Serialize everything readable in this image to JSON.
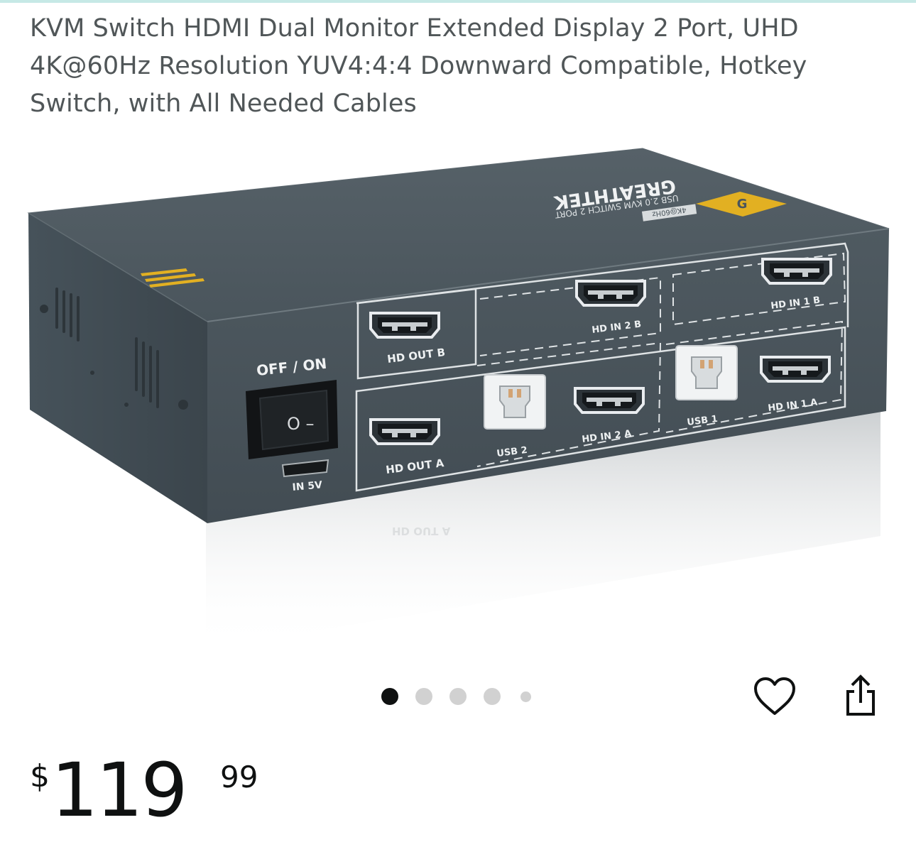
{
  "product": {
    "title": "KVM Switch HDMI Dual Monitor Extended Display 2 Port, UHD 4K@60Hz Resolution YUV4:4:4 Downward Compatible, Hotkey Switch, with All Needed Cables"
  },
  "device_labels": {
    "brand": "GREATHTEK",
    "model": "USB 2.0 KVM SWITCH 2 PORT",
    "badge": "4K@60Hz",
    "power_switch": "OFF / ON",
    "switch_symbols": "O –",
    "power_in": "IN 5V",
    "hd_out_b": "HD OUT B",
    "hd_out_a": "HD OUT A",
    "hd_in_2b": "HD IN 2 B",
    "hd_in_1b": "HD IN 1 B",
    "hd_in_2a": "HD IN 2 A",
    "hd_in_1a": "HD IN 1 A",
    "usb_2": "USB 2",
    "usb_1": "USB 1"
  },
  "carousel": {
    "total": 5,
    "active_index": 0
  },
  "actions": {
    "favorite_icon": "heart-icon",
    "share_icon": "share-icon"
  },
  "price": {
    "currency": "$",
    "whole": "119",
    "fraction": "99"
  },
  "colors": {
    "title_text": "#505658",
    "dot_active": "#0f1111",
    "dot_inactive": "#d1d1d1",
    "device_body": "#4a565d",
    "accent": "#e2b022"
  }
}
